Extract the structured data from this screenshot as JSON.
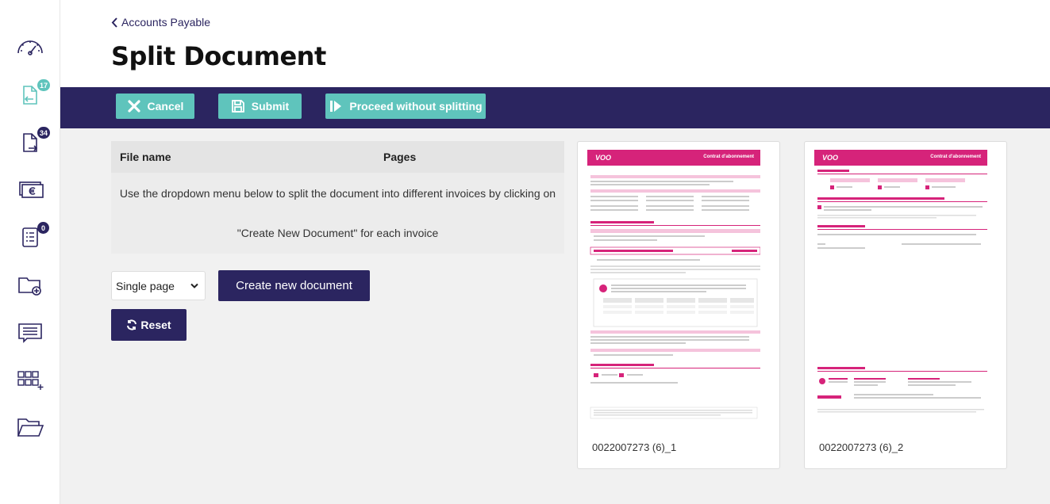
{
  "sidebar": {
    "items": [
      {
        "name": "dashboard-icon"
      },
      {
        "name": "incoming-documents-icon",
        "badge": "17"
      },
      {
        "name": "outgoing-documents-icon",
        "badge": "34"
      },
      {
        "name": "payments-icon"
      },
      {
        "name": "tasks-icon",
        "badge": "0"
      },
      {
        "name": "add-folder-icon"
      },
      {
        "name": "messages-icon"
      },
      {
        "name": "apps-grid-icon"
      },
      {
        "name": "open-folder-icon"
      }
    ]
  },
  "header": {
    "breadcrumb": "Accounts Payable",
    "title": "Split Document"
  },
  "toolbar": {
    "cancel_label": "Cancel",
    "submit_label": "Submit",
    "proceed_label": "Proceed without splitting"
  },
  "table": {
    "col_file": "File name",
    "col_pages": "Pages",
    "instruction_line1": "Use the dropdown menu below to split the document into different invoices by clicking on",
    "instruction_line2": "\"Create New Document\" for each invoice"
  },
  "controls": {
    "split_mode_selected": "Single page",
    "create_label": "Create new document",
    "reset_label": "Reset"
  },
  "pages": [
    {
      "label": "0022007273 (6)_1",
      "thumb_logo": "VOO",
      "thumb_title": "Contrat d'abonnement"
    },
    {
      "label": "0022007273 (6)_2",
      "thumb_logo": "VOO",
      "thumb_title": "Contrat d'abonnement"
    }
  ],
  "colors": {
    "navy": "#2b2560",
    "teal": "#5fc4bc",
    "magenta": "#d6237a"
  }
}
